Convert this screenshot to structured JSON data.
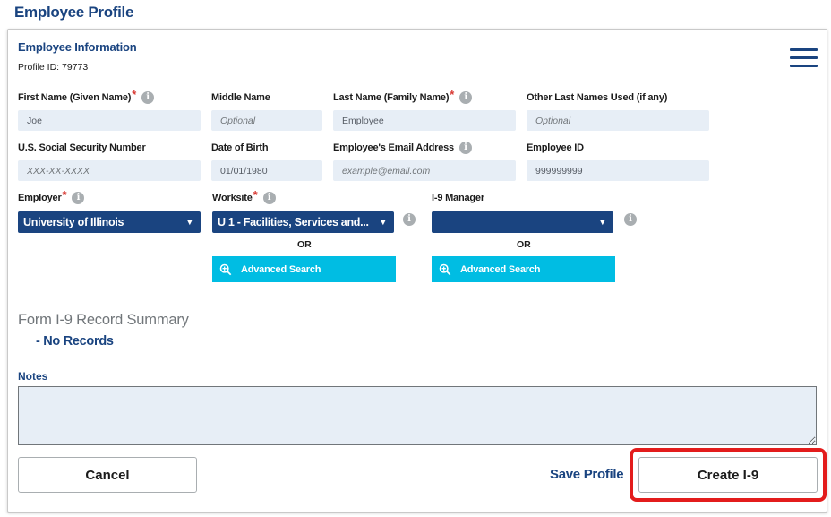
{
  "page": {
    "title": "Employee Profile"
  },
  "employee_info": {
    "title": "Employee Information",
    "profile_id": "Profile ID: 79773",
    "fields": {
      "first_name": {
        "label": "First Name (Given Name)",
        "value": "Joe",
        "placeholder": ""
      },
      "middle_name": {
        "label": "Middle Name",
        "value": "",
        "placeholder": "Optional"
      },
      "last_name": {
        "label": "Last Name (Family Name)",
        "value": "Employee",
        "placeholder": ""
      },
      "other_last_names": {
        "label": "Other Last Names Used (if any)",
        "value": "",
        "placeholder": "Optional"
      },
      "ssn": {
        "label": "U.S. Social Security Number",
        "value": "",
        "placeholder": "XXX-XX-XXXX"
      },
      "dob": {
        "label": "Date of Birth",
        "value": "01/01/1980",
        "placeholder": ""
      },
      "email": {
        "label": "Employee's Email Address",
        "value": "",
        "placeholder": "example@email.com"
      },
      "employee_id": {
        "label": "Employee ID",
        "value": "999999999",
        "placeholder": ""
      }
    },
    "employer": {
      "label": "Employer",
      "value": "University of Illinois"
    },
    "worksite": {
      "label": "Worksite",
      "value": "U 1 - Facilities, Services and..."
    },
    "i9_manager": {
      "label": "I-9 Manager",
      "value": ""
    },
    "or_text": "OR",
    "advanced_search_label": "Advanced Search"
  },
  "record_summary": {
    "title": "Form I-9 Record Summary",
    "empty_text": "- No Records"
  },
  "notes": {
    "label": "Notes",
    "value": ""
  },
  "actions": {
    "cancel": "Cancel",
    "save_profile": "Save Profile",
    "create_i9": "Create I-9"
  },
  "icons": {
    "info": "info-icon",
    "menu": "hamburger-menu-icon",
    "search": "magnifier-plus-icon",
    "caret": "caret-down-icon"
  },
  "colors": {
    "primary": "#1a4480",
    "accent": "#00bde3",
    "required": "#d83933",
    "input_bg": "#e7eef6",
    "highlight": "#e31c1c"
  }
}
